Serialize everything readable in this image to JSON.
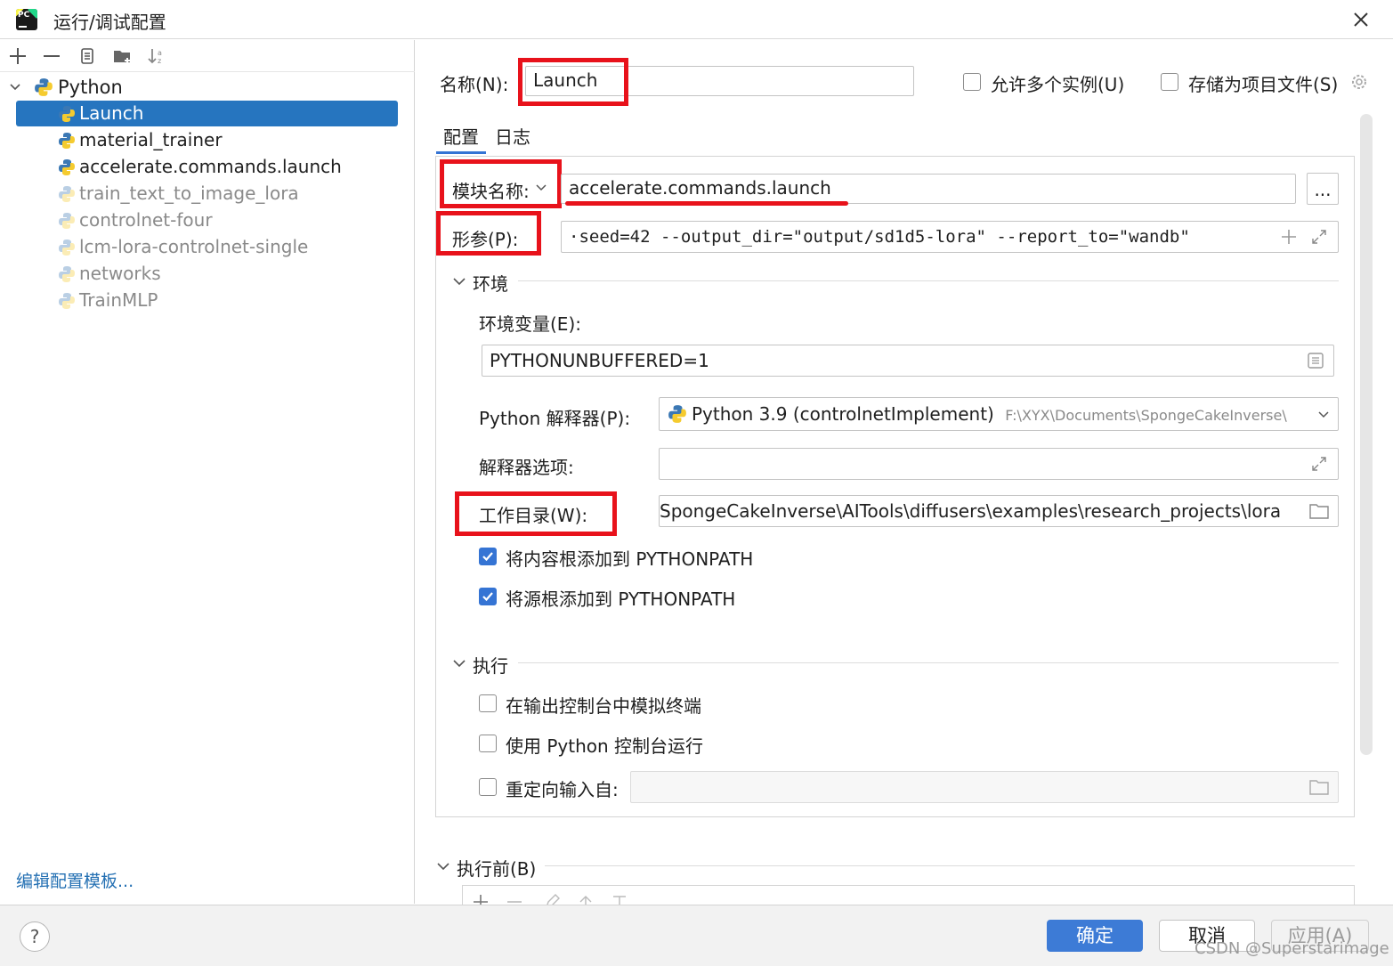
{
  "window": {
    "title": "运行/调试配置"
  },
  "sidebar": {
    "group": "Python",
    "items": [
      {
        "label": "Launch",
        "selected": true
      },
      {
        "label": "material_trainer"
      },
      {
        "label": "accelerate.commands.launch"
      },
      {
        "label": "train_text_to_image_lora",
        "dimmed": true
      },
      {
        "label": "controlnet-four",
        "dimmed": true
      },
      {
        "label": "lcm-lora-controlnet-single",
        "dimmed": true
      },
      {
        "label": "networks",
        "dimmed": true
      },
      {
        "label": "TrainMLP",
        "dimmed": true
      }
    ],
    "edit_templates_link": "编辑配置模板..."
  },
  "form": {
    "name_label": "名称(N):",
    "name_value": "Launch",
    "allow_multiple_label": "允许多个实例(U)",
    "store_as_file_label": "存储为项目文件(S)",
    "tabs": [
      "配置",
      "日志"
    ],
    "module_label": "模块名称:",
    "module_value": "accelerate.commands.launch",
    "module_browse": "...",
    "params_label": "形参(P):",
    "params_value": "·seed=42 --output_dir=\"output/sd1d5-lora\" --report_to=\"wandb\"",
    "env_section": "环境",
    "env_vars_label": "环境变量(E):",
    "env_vars_value": "PYTHONUNBUFFERED=1",
    "interpreter_label": "Python 解释器(P):",
    "interpreter_value": "Python 3.9 (controlnetImplement)",
    "interpreter_path": "F:\\XYX\\Documents\\SpongeCakeInverse\\",
    "interp_options_label": "解释器选项:",
    "interp_options_value": "",
    "workdir_label": "工作目录(W):",
    "workdir_value": "SpongeCakeInverse\\AITools\\diffusers\\examples\\research_projects\\lora",
    "add_content_roots": "将内容根添加到 PYTHONPATH",
    "add_source_roots": "将源根添加到 PYTHONPATH",
    "exec_section": "执行",
    "emulate_terminal": "在输出控制台中模拟终端",
    "run_python_console": "使用 Python 控制台运行",
    "redirect_input": "重定向输入自:",
    "before_launch": "执行前(B)"
  },
  "buttons": {
    "ok": "确定",
    "cancel": "取消",
    "apply": "应用(A)",
    "help": "?"
  },
  "watermark": "CSDN @Superstarimage",
  "colors": {
    "selection": "#2675bf",
    "highlight": "#e8121b",
    "ok_button": "#3d7bd6",
    "link": "#2470b3"
  }
}
